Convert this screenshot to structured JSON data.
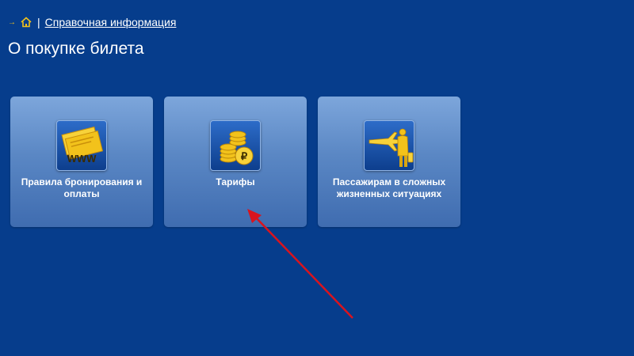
{
  "breadcrumb": {
    "arrow": "→",
    "separator": "|",
    "link_label": "Справочная информация"
  },
  "page": {
    "title": "О покупке билета"
  },
  "tiles": [
    {
      "label": "Правила бронирования и оплаты",
      "icon": "www-tickets-icon"
    },
    {
      "label": "Тарифы",
      "icon": "coins-ruble-icon"
    },
    {
      "label": "Пассажирам в сложных жизненных ситуациях",
      "icon": "airplane-passenger-icon"
    }
  ],
  "colors": {
    "background": "#063d8c",
    "tile_top": "#7da6db",
    "tile_bottom": "#3f6cb0",
    "icon_gold": "#f2c21b",
    "annotation_arrow": "#d9141e"
  },
  "icon_names": {
    "home": "home-icon",
    "annotation": "red-arrow-annotation"
  }
}
